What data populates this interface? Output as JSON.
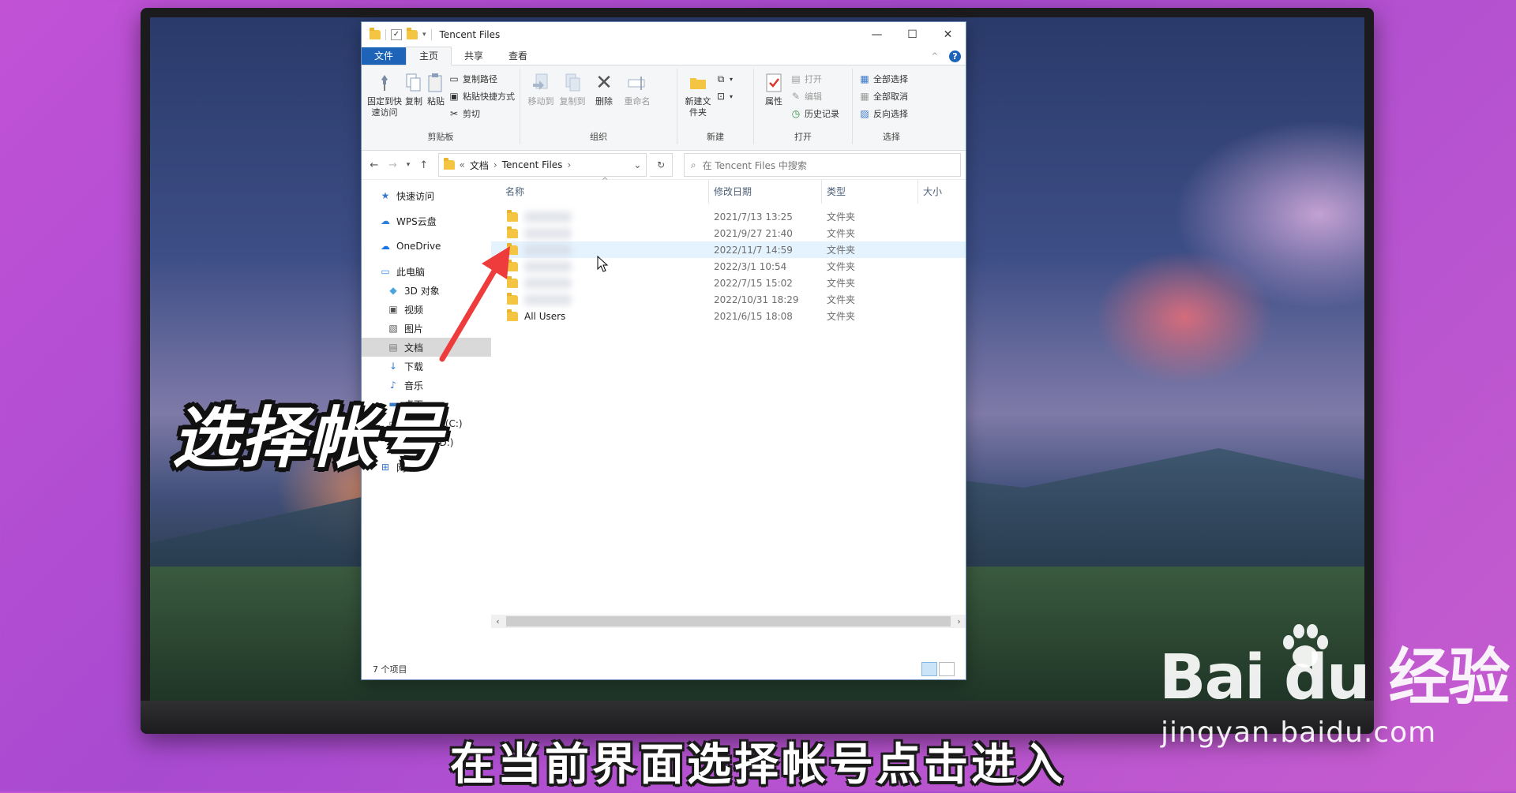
{
  "window": {
    "title": "Tencent Files",
    "controls": {
      "minimize": "—",
      "maximize": "☐",
      "close": "✕"
    }
  },
  "ribbon_tabs": [
    "文件",
    "主页",
    "共享",
    "查看"
  ],
  "ribbon": {
    "clipboard": {
      "label": "剪贴板",
      "pin": "固定到快速访问",
      "copy": "复制",
      "paste": "粘贴",
      "copy_path": "复制路径",
      "paste_shortcut": "粘贴快捷方式",
      "cut": "剪切"
    },
    "organize": {
      "label": "组织",
      "move_to": "移动到",
      "copy_to": "复制到",
      "delete": "删除",
      "rename": "重命名"
    },
    "new": {
      "label": "新建",
      "new_folder": "新建文件夹"
    },
    "open": {
      "label": "打开",
      "properties": "属性",
      "open": "打开",
      "edit": "编辑",
      "history": "历史记录"
    },
    "select": {
      "label": "选择",
      "select_all": "全部选择",
      "select_none": "全部取消",
      "invert": "反向选择"
    }
  },
  "address": {
    "prefix": "«",
    "crumbs": [
      "文档",
      "Tencent Files"
    ],
    "search_placeholder": "在 Tencent Files 中搜索"
  },
  "nav": [
    {
      "label": "快速访问",
      "icon": "star-icon",
      "sub": false
    },
    {
      "label": "WPS云盘",
      "icon": "cloud-icon",
      "sub": false
    },
    {
      "label": "OneDrive",
      "icon": "onedrive-icon",
      "sub": false
    },
    {
      "label": "此电脑",
      "icon": "computer-icon",
      "sub": false
    },
    {
      "label": "3D 对象",
      "icon": "cube-icon",
      "sub": true
    },
    {
      "label": "视频",
      "icon": "video-icon",
      "sub": true
    },
    {
      "label": "图片",
      "icon": "picture-icon",
      "sub": true
    },
    {
      "label": "文档",
      "icon": "document-icon",
      "sub": true,
      "selected": true
    },
    {
      "label": "下载",
      "icon": "download-icon",
      "sub": true
    },
    {
      "label": "音乐",
      "icon": "music-icon",
      "sub": true
    },
    {
      "label": "桌面",
      "icon": "desktop-icon",
      "sub": true
    },
    {
      "label": "本地磁盘 (C:)",
      "icon": "drive-icon",
      "sub": true
    },
    {
      "label": "新加卷 (D:)",
      "icon": "drive-icon",
      "sub": true
    },
    {
      "label": "网络",
      "icon": "network-icon",
      "sub": false
    }
  ],
  "columns": {
    "name": "名称",
    "date": "修改日期",
    "type": "类型",
    "size": "大小"
  },
  "files": [
    {
      "name": "",
      "date": "2021/7/13 13:25",
      "type": "文件夹",
      "blurred": true
    },
    {
      "name": "",
      "date": "2021/9/27 21:40",
      "type": "文件夹",
      "blurred": true
    },
    {
      "name": "",
      "date": "2022/11/7 14:59",
      "type": "文件夹",
      "blurred": true,
      "hover": true
    },
    {
      "name": "",
      "date": "2022/3/1 10:54",
      "type": "文件夹",
      "blurred": true
    },
    {
      "name": "",
      "date": "2022/7/15 15:02",
      "type": "文件夹",
      "blurred": true
    },
    {
      "name": "",
      "date": "2022/10/31 18:29",
      "type": "文件夹",
      "blurred": true
    },
    {
      "name": "All Users",
      "date": "2021/6/15 18:08",
      "type": "文件夹",
      "blurred": false
    }
  ],
  "status": {
    "item_count": "7 个项目"
  },
  "overlay": {
    "caption": "选择帐号",
    "subtitle": "在当前界面选择帐号点击进入",
    "watermark_logo": "Bai du 经验",
    "watermark_url": "jingyan.baidu.com"
  },
  "colors": {
    "file_tab": "#1d64b8",
    "folder": "#f4c542",
    "hover_row": "#e5f3ff",
    "arrow": "#ee3b3b"
  }
}
